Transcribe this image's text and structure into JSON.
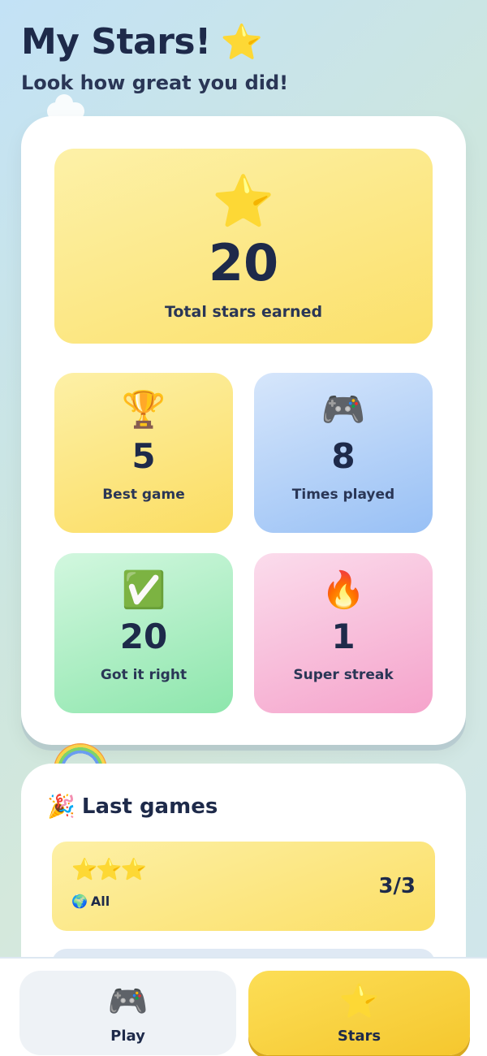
{
  "header": {
    "title": "My Stars!",
    "title_icon": "⭐",
    "subtitle": "Look how great you did!"
  },
  "stats": {
    "total": {
      "icon": "⭐",
      "value": "20",
      "label": "Total stars earned"
    },
    "best_game": {
      "icon": "🏆",
      "value": "5",
      "label": "Best game"
    },
    "times_played": {
      "icon": "🎮",
      "value": "8",
      "label": "Times played"
    },
    "got_it_right": {
      "icon": "✅",
      "value": "20",
      "label": "Got it right"
    },
    "super_streak": {
      "icon": "🔥",
      "value": "1",
      "label": "Super streak"
    }
  },
  "last_games": {
    "icon": "🎉",
    "title": "Last games",
    "items": [
      {
        "stars": "⭐⭐⭐",
        "category_icon": "🌍",
        "category": "All",
        "score": "3/3"
      }
    ]
  },
  "nav": {
    "play": {
      "icon": "🎮",
      "label": "Play"
    },
    "stars": {
      "icon": "⭐",
      "label": "Stars"
    }
  },
  "colors": {
    "text": "#1e2a4a",
    "yellow": "#fbe06a",
    "blue": "#98c0f5",
    "green": "#8de6ac",
    "pink": "#f5a3cb",
    "nav_active": "#f5c72e"
  }
}
